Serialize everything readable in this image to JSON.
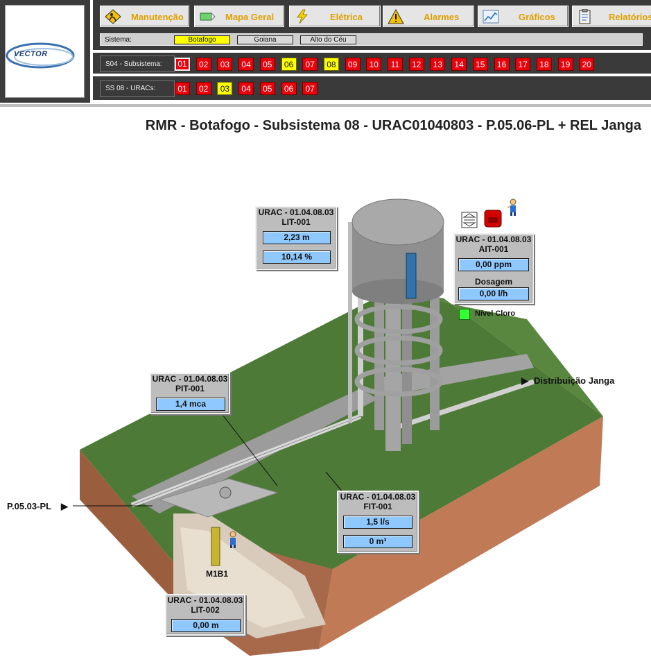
{
  "logo": {
    "text": "VECTOR"
  },
  "nav": [
    {
      "label": "Manutenção",
      "icon": "maintenance-icon"
    },
    {
      "label": "Mapa Geral",
      "icon": "map-icon"
    },
    {
      "label": "Elétrica",
      "icon": "lightning-icon"
    },
    {
      "label": "Alarmes",
      "icon": "warning-icon"
    },
    {
      "label": "Gráficos",
      "icon": "chart-icon"
    },
    {
      "label": "Relatórios",
      "icon": "report-icon"
    }
  ],
  "system": {
    "label": "Sistema:",
    "options": [
      {
        "label": "Botafogo",
        "color": "#ffff00"
      },
      {
        "label": "Goiana",
        "color": "#d9d9d9"
      },
      {
        "label": "Alto do Céu",
        "color": "#d9d9d9"
      }
    ]
  },
  "subsystem": {
    "label": "S04 - Subsistema:",
    "items": [
      "01",
      "02",
      "03",
      "04",
      "05",
      "06",
      "07",
      "08",
      "09",
      "10",
      "11",
      "12",
      "13",
      "14",
      "15",
      "16",
      "17",
      "18",
      "19",
      "20"
    ],
    "yellow": [
      "06",
      "08"
    ],
    "selected": "01"
  },
  "uracs": {
    "label": "SS 08 - URACs:",
    "items": [
      "01",
      "02",
      "03",
      "04",
      "05",
      "06",
      "07"
    ],
    "yellow": [
      "03"
    ]
  },
  "title": "RMR - Botafogo - Subsistema 08 - URAC01040803 - P.05.06-PL + REL Janga",
  "panels": {
    "lit001": {
      "header": "URAC - 01.04.08.03",
      "tag": "LIT-001",
      "value1": "2,23 m",
      "value2": "10,14 %"
    },
    "ait001": {
      "header": "URAC - 01.04.08.03",
      "tag": "AIT-001",
      "value1": "0,00 ppm",
      "dosagem": "Dosagem",
      "value2": "0,00 l/h"
    },
    "pit001": {
      "header": "URAC - 01.04.08.03",
      "tag": "PIT-001",
      "value1": "1,4 mca"
    },
    "fit001": {
      "header": "URAC - 01.04.08.03",
      "tag": "FIT-001",
      "value1": "1,5 l/s",
      "value2": "0 m³"
    },
    "lit002": {
      "header": "URAC - 01.04.08.03",
      "tag": "LIT-002",
      "value1": "0,00 m"
    }
  },
  "labels": {
    "nivel_cloro": "Nível Cloro",
    "distribuicao": "Distribuição Janga",
    "p0503": "P.05.03-PL",
    "m1b1": "M1B1"
  },
  "colors": {
    "alarm_red": "#e8000a",
    "warn_yellow": "#ffff00",
    "value_blue": "#8fc8ff",
    "status_green": "#33ff33"
  }
}
